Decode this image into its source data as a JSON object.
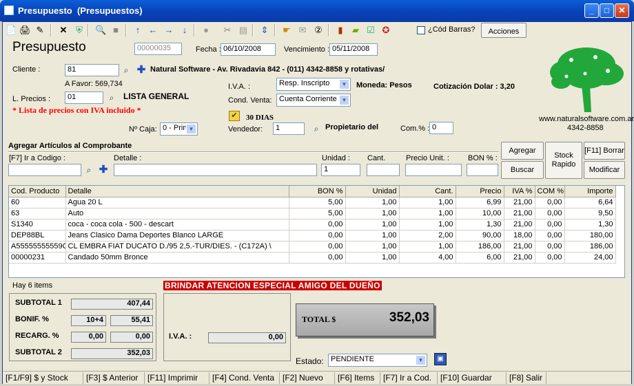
{
  "window": {
    "title": "Presupuesto  (Presupuestos)"
  },
  "toolbar": {
    "codbarras_label": "¿Cód Barras?",
    "acciones_label": "Acciones"
  },
  "form": {
    "heading": "Presupuesto",
    "number": "00000035",
    "fecha_label": "Fecha :",
    "fecha": "06/10/2008",
    "vencimiento_label": "Vencimiento :",
    "vencimiento": "05/11/2008",
    "cliente_label": "Cliente :",
    "cliente_code": "81",
    "cliente_desc": "Natural Software - Av. Rivadavia 842 - (011)  4342-8858   y rotativas/",
    "a_favor": "A Favor: 569,734",
    "lprecios_label": "L. Precios :",
    "lprecios_code": "01",
    "lprecios_name": "LISTA GENERAL",
    "iva_note": "* Lista de precios con IVA incluido *",
    "iva_label": "I.V.A. :",
    "iva_value": "Resp. Inscripto",
    "moneda": "Moneda: Pesos",
    "cotizacion": "Cotización Dolar : 3,20",
    "condventa_label": "Cond. Venta:",
    "condventa_value": "Cuenta Corriente",
    "dias": "30 DIAS",
    "vendedor_label": "Vendedor:",
    "vendedor_code": "1",
    "vendedor_name": "Propietario del",
    "com_label": "Com.% :",
    "com_value": "0",
    "caja_label": "Nº Caja:",
    "caja_value": "0 - Prin",
    "website": "www.naturalsoftware.com.ar",
    "phone": "4342-8858"
  },
  "agregar": {
    "section_title": "Agregar Artículos al Comprobante",
    "codigo_label": "[F7] Ir a Codigo :",
    "detalle_label": "Detalle :",
    "unidad_label": "Unidad :",
    "unidad_value": "1",
    "cant_label": "Cant.",
    "precio_label": "Precio Unit. :",
    "bon_label": "BON % :",
    "btn_agregar": "Agregar",
    "btn_buscar": "Buscar",
    "btn_stock_rapido": "Stock\nRapido",
    "btn_borrar": "[F11] Borrar",
    "btn_modificar": "Modificar"
  },
  "grid": {
    "columns": [
      "Cod. Producto",
      "Detalle",
      "BON %",
      "Unidad",
      "Cant.",
      "Precio",
      "IVA %",
      "COM %",
      "Importe"
    ],
    "rows": [
      [
        "60",
        "Agua 20 L",
        "5,00",
        "1,00",
        "1,00",
        "6,99",
        "21,00",
        "0,00",
        "6,64"
      ],
      [
        "63",
        "Auto",
        "5,00",
        "1,00",
        "1,00",
        "10,00",
        "21,00",
        "0,00",
        "9,50"
      ],
      [
        "S1340",
        "coca - coca cola - 500 - descart",
        "0,00",
        "1,00",
        "1,00",
        "1,30",
        "21,00",
        "0,00",
        "1,30"
      ],
      [
        "DEP88BL",
        "Jeans Clasico Dama Deportes Blanco LARGE",
        "0,00",
        "1,00",
        "2,00",
        "90,00",
        "18,00",
        "0,00",
        "180,00"
      ],
      [
        "A55555555559C",
        " CL EMBRA FIAT DUCATO D./95 2,5.-TUR/DIES. - (C172A) \\",
        "0,00",
        "1,00",
        "1,00",
        "186,00",
        "21,00",
        "0,00",
        "186,00"
      ],
      [
        "00000231",
        "Candado 50mm Bronce",
        "0,00",
        "1,00",
        "4,00",
        "6,00",
        "21,00",
        "0,00",
        "24,00"
      ]
    ]
  },
  "summary": {
    "items_count": "Hay 6 items",
    "alert": "BRINDAR ATENCION ESPECIAL AMIGO DEL DUEÑO",
    "subtotal1_label": "SUBTOTAL 1",
    "subtotal1": "407,44",
    "bonif_label": "BONIF. %",
    "bonif_pct": "10+4",
    "bonif_value": "55,41",
    "recarg_label": "RECARG. %",
    "recarg_pct": "0,00",
    "recarg_value": "0,00",
    "subtotal2_label": "SUBTOTAL 2",
    "subtotal2": "352,03",
    "iva_label": "I.V.A. :",
    "iva_value": "0,00",
    "total_label": "TOTAL $",
    "total": "352,03",
    "estado_label": "Estado:",
    "estado_value": "PENDIENTE"
  },
  "statusbar": [
    "[F1/F9] $ y Stock",
    "[F3] $ Anterior",
    "[F11] Imprimir",
    "[F4] Cond. Venta",
    "[F2] Nuevo",
    "[F6] Items",
    "[F7] Ir a Cod.",
    "[F10] Guardar",
    "[F8] Salir"
  ],
  "colors": {
    "alert_bg": "#cc0000",
    "iva_note": "#ff0000",
    "tree": "#22a83a"
  }
}
